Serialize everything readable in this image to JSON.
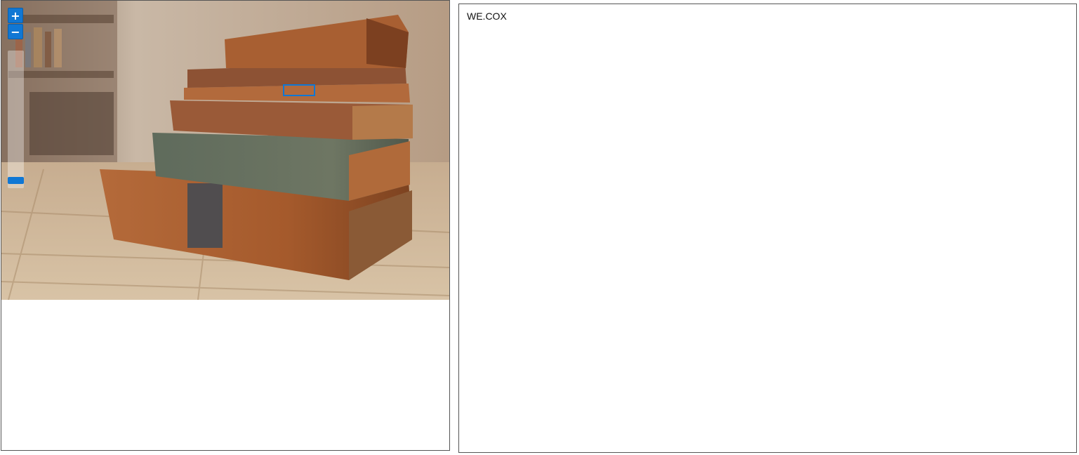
{
  "viewer": {
    "zoom_in_label": "+",
    "zoom_out_label": "−",
    "zoom_level": 0.08,
    "highlight_color": "#1077d4"
  },
  "text_panel": {
    "content": "WE.COX"
  }
}
